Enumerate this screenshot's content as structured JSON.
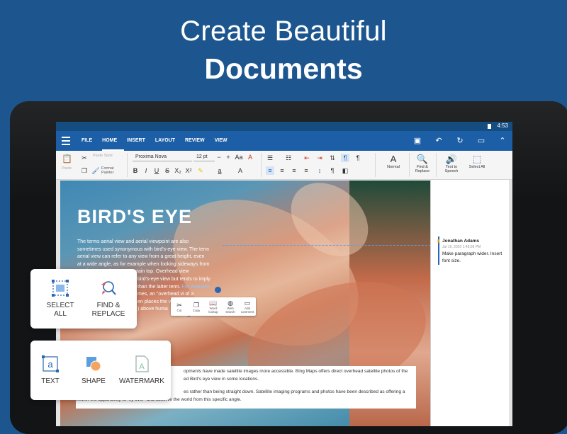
{
  "headline": {
    "line1": "Create Beautiful",
    "line2": "Documents"
  },
  "status": {
    "time": "4:53"
  },
  "menu": {
    "tabs": [
      "FILE",
      "HOME",
      "INSERT",
      "LAYOUT",
      "REVIEW",
      "VIEW"
    ],
    "active": "HOME"
  },
  "ribbon": {
    "paste": "Paste",
    "paste_style": "Paste Style",
    "format_painter": "Format Painter",
    "font_name": "Proxima Nova",
    "font_size": "12 pt",
    "style_normal": "Normal",
    "find_replace": "Find & Replace",
    "text_to_speech": "Text to Speech",
    "select_all": "Select All"
  },
  "document": {
    "title": "BIRD'S EYE",
    "body_lines": [
      "The terms aerial view and aerial viewpoint are also",
      "sometimes used synonymous with bird's-eye view. The term",
      "aerial view can refer to any view from a great height, even",
      "at a wide angle, as for example when looking sideways from",
      "an airplane or from a mountain top. Overhead view",
      "bird's-eye view but tends to imply",
      "than the latter term.",
      "mes, an \"overhead vi of a",
      "en places the v",
      ") above huma"
    ],
    "link_text": "For example,",
    "box_lines": [
      "opments have made satellite images more accessible. Bing Maps offers direct overhead satellite photos of the",
      "ed Bird's eye view in some locations.",
      "es rather than being straight down. Satellite imaging programs and photos have been described as offering a",
      "viewer the opportunity to \"fly over\" and observe the world from this specific angle."
    ]
  },
  "comment": {
    "author": "Jonathan Adams",
    "date": "Jul 16, 2020 1:48:09 PM",
    "text": "Make paragraph wider. Insert font size."
  },
  "context_menu": {
    "items": [
      "Cut",
      "Copy",
      "Word lookup",
      "Web search",
      "Add comment"
    ]
  },
  "card_top": {
    "items": [
      "SELECT\nALL",
      "FIND &\nREPLACE"
    ]
  },
  "card_bottom": {
    "items": [
      "TEXT",
      "SHAPE",
      "WATERMARK"
    ]
  },
  "colors": {
    "background": "#1d568f",
    "menubar": "#1d5fa6",
    "accent": "#2a66b2"
  }
}
